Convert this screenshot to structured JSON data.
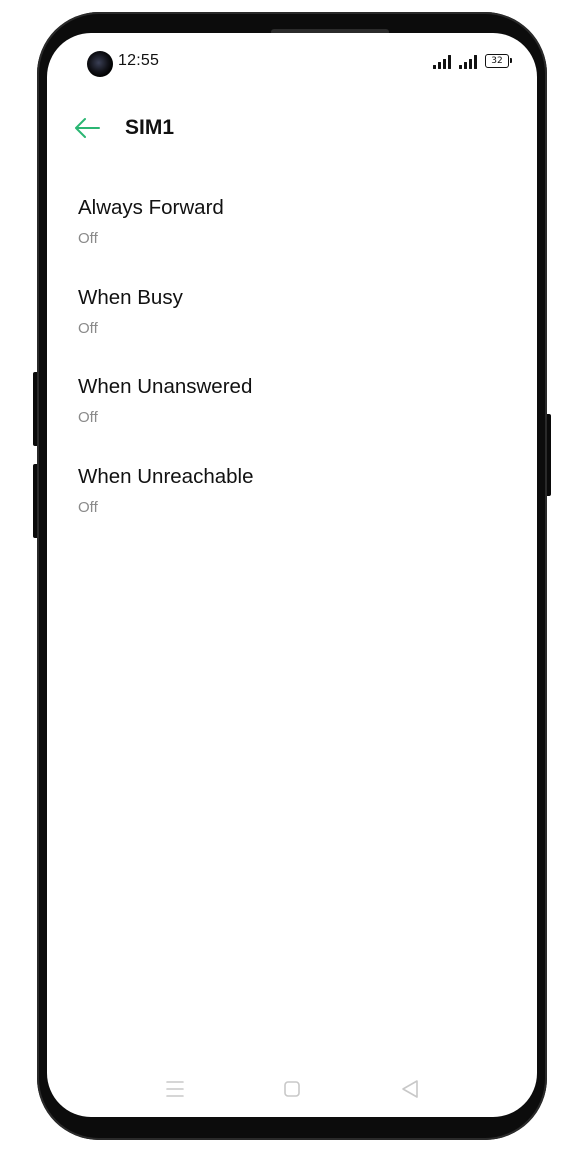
{
  "status_bar": {
    "time": "12:55",
    "battery_level": "32"
  },
  "header": {
    "title": "SIM1",
    "back_icon": "arrow-left-icon"
  },
  "forwarding_options": [
    {
      "title": "Always Forward",
      "status": "Off"
    },
    {
      "title": "When Busy",
      "status": "Off"
    },
    {
      "title": "When Unanswered",
      "status": "Off"
    },
    {
      "title": "When Unreachable",
      "status": "Off"
    }
  ],
  "nav_bar": {
    "menu_icon": "menu-icon",
    "home_icon": "home-square-icon",
    "back_icon": "back-triangle-icon"
  },
  "colors": {
    "accent": "#2bb673",
    "text_primary": "#111111",
    "text_secondary": "#8a8a8a",
    "nav_icon": "#c8c8c8"
  }
}
